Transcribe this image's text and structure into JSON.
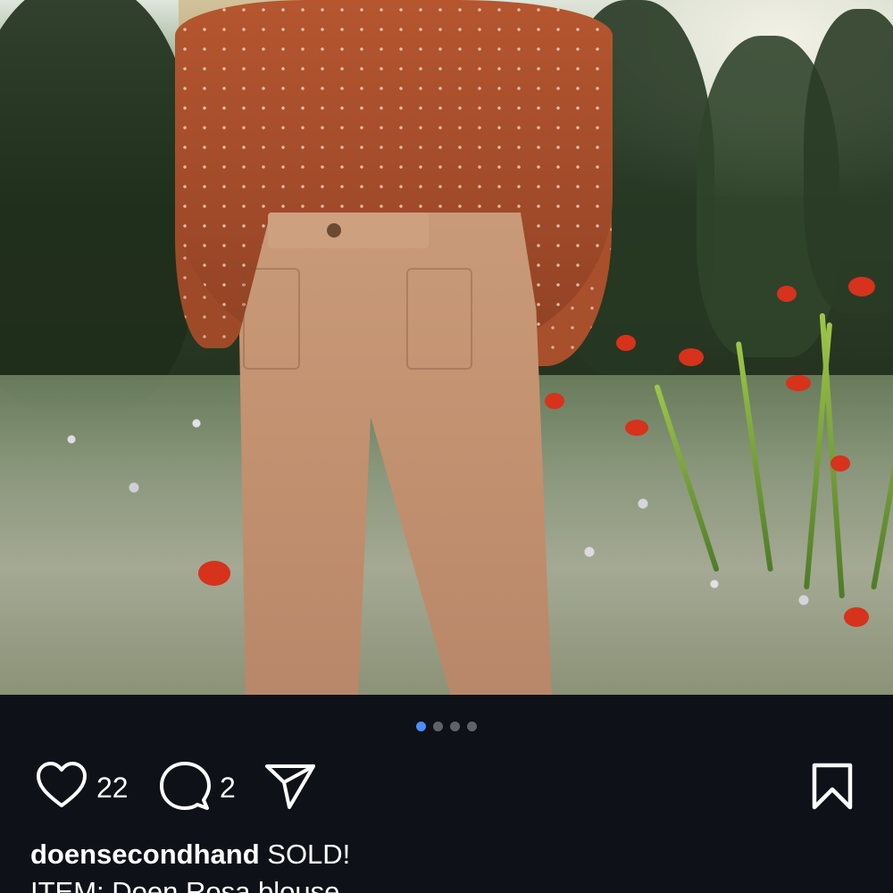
{
  "post": {
    "photo_alt": "post-photo",
    "carousel": {
      "total": 4,
      "active_index": 0
    },
    "likes": "22",
    "comments": "2",
    "caption": {
      "username": "doensecondhand",
      "text": "SOLD!",
      "second_line": "ITEM: Doen Rosa blouse"
    }
  },
  "icons": {
    "like": "heart-outline-icon",
    "comment": "comment-bubble-icon",
    "share": "paper-plane-icon",
    "save": "bookmark-outline-icon"
  },
  "colors": {
    "background": "#0e1117",
    "text": "#ffffff",
    "carousel_active": "#4c8dff",
    "carousel_inactive": "#5f6368"
  }
}
